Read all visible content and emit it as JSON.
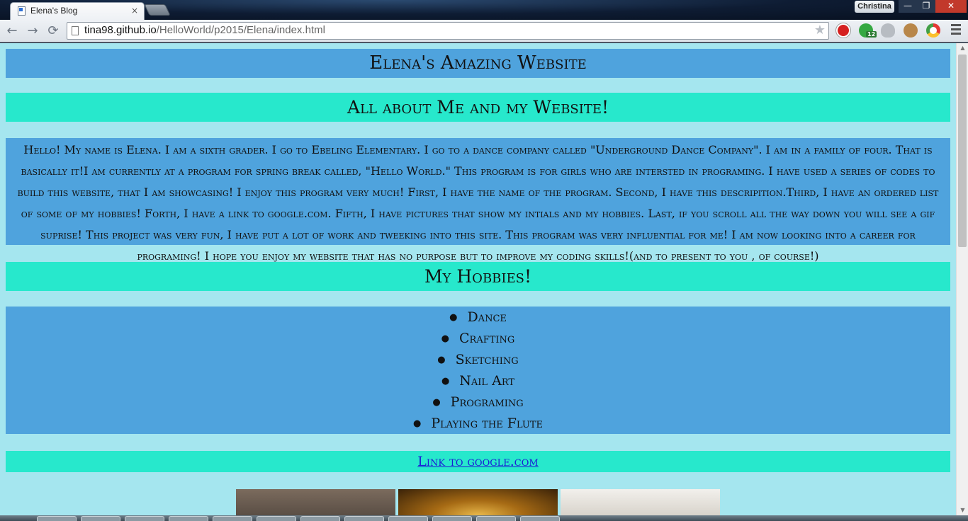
{
  "browser": {
    "tab_title": "Elena's Blog",
    "tab_close": "×",
    "profile_name": "Christina",
    "url_host": "tina98.github.io",
    "url_path": "/HelloWorld/p2015/Elena/index.html",
    "ext_badge": "12",
    "window_min": "—",
    "window_max": "❐",
    "window_close": "✕"
  },
  "page": {
    "title": "Elena's Amazing Website",
    "about_heading": "All about Me and my Website!",
    "about_text": "Hello! My name is Elena. I am a sixth grader. I go to Ebeling Elementary. I go to a dance company called \"Underground Dance Company\". I am in a family of four. That is basically it!I am currently at a program for spring break called, \"Hello World.\" This program is for girls who are intersted in programing. I have used a series of codes to build this website, that I am showcasing! I enjoy this program very much! First, I have the name of the program. Second, I have this descripition.Third, I have an ordered list of some of my hobbies! Forth, I have a link to google.com. Fifth, I have pictures that show my intials and my hobbies. Last, if you scroll all the way down you will see a gif suprise! This project was very fun, I have put a lot of work and tweeking into this site. This program was very influential for me! I am now looking into a career for programing! I hope you enjoy my website that has no purpose but to improve my coding skills!(and to present to you , of course!)",
    "hobbies_heading": "My Hobbies!",
    "hobbies": [
      "Dance",
      "Crafting",
      "Sketching",
      "Nail Art",
      "Programing",
      "Playing the Flute"
    ],
    "link_text": "Link to google.com"
  },
  "colors": {
    "page_background": "#a5e6ef",
    "blue_block": "#4fa3dd",
    "teal_block": "#27e8cc",
    "link": "#1b1bd6"
  }
}
